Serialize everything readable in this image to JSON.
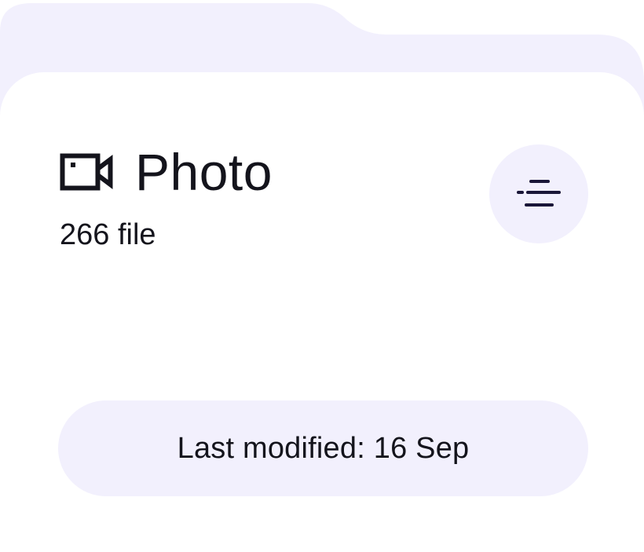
{
  "card": {
    "title": "Photo",
    "file_count": "266 file",
    "last_modified": "Last modified: 16 Sep"
  },
  "icons": {
    "title_icon": "video-camera-icon",
    "menu_icon": "filter-lines-icon"
  },
  "colors": {
    "folder_tint": "#f2f0fd",
    "text": "#14141c",
    "icon_stroke": "#14141c",
    "menu_stroke": "#1a1638"
  }
}
